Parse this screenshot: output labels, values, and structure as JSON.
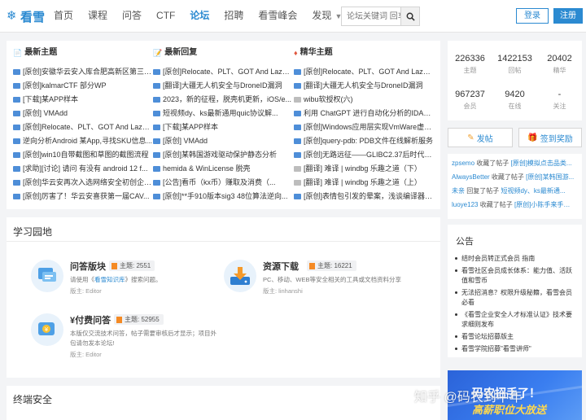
{
  "header": {
    "logo_text": "看雪",
    "nav": [
      "首页",
      "课程",
      "问答",
      "CTF",
      "论坛",
      "招聘",
      "看雪峰会",
      "发现"
    ],
    "active_nav": "论坛",
    "search_placeholder": "论坛关键词 回车",
    "login": "登录",
    "register": "注册"
  },
  "topics": {
    "latest": {
      "title": "最新主题",
      "items": [
        "[原创]安徽华云安入库合肥高新区第三批...",
        "[原创]kalmarCTF 部分WP",
        "[下载]某APP样本",
        "[原创] VMAdd",
        "[原创]Relocate、PLT、GOT And Lazy Bin...",
        "逆向分析Android 某App,寻找SKU信息...",
        "[原创]win10自带截图和草图的截图流程",
        "[求助][讨论] 请问 有没有 android 12 f...",
        "[原创]华云安再次入选网络安全初创企业...",
        "[原创]厉害了！华云安喜获第一届CAV..."
      ]
    },
    "replies": {
      "title": "最新回复",
      "items": [
        "[原创]Relocate、PLT、GOT And Lazy Bi...",
        "[翻译]大疆无人机安全与DroneID漏洞",
        "2023，新的征程，脱壳机更新，iOS/e...",
        "短视频dy、ks最新通用quic协议解...",
        "[下载]某APP样本",
        "[原创] VMAdd",
        "[原创]某韩国游戏驱动保护静态分析",
        "hemida & WinLicense 脱壳",
        "[公告]看币（kx币）赚取及消费（...",
        "[原创]**手910版本sig3 48位算法逆向..."
      ]
    },
    "featured": {
      "title": "精华主题",
      "items": [
        "[原创]Relocate、PLT、GOT And Lazy Bin...",
        "[翻译]大疆无人机安全与DroneID漏洞",
        "wibu软授权(六)",
        "利用 ChatGPT 进行自动化分析的IDA插件...",
        "[原创]Windows应用层实现VmWare虚拟...",
        "[原创]query-pdb: PDB文件在线解析服务",
        "[原创]无路远征——GLIBC2.37后时代的I...",
        "[翻译] 难译 | windbg 乐趣之道（下）",
        "[翻译] 难译 | windbg 乐趣之道（上）",
        "[原创]表情包引发的晕案，浅谈编译器优化"
      ]
    }
  },
  "stats": [
    {
      "num": "226336",
      "label": "主题"
    },
    {
      "num": "1422153",
      "label": "回帖"
    },
    {
      "num": "20402",
      "label": "精华"
    },
    {
      "num": "967237",
      "label": "会员"
    },
    {
      "num": "9420",
      "label": "在线"
    },
    {
      "num": "-",
      "label": "关注"
    }
  ],
  "actions": {
    "post": "发帖",
    "signin": "签到奖励"
  },
  "activity": [
    {
      "user": "zpsemo",
      "verb": " 收藏了帖子 ",
      "link": "[原创]模拟点击品类..."
    },
    {
      "user": "AlwaysBetter",
      "verb": " 收藏了帖子 ",
      "link": "[原创]某韩国游..."
    },
    {
      "user": "未亲",
      "verb": " 回复了帖子 ",
      "link": "短视频dy、ks最新通..."
    },
    {
      "user": "luoye123",
      "verb": " 收藏了帖子 ",
      "link": "[原创]小陈手来手…"
    }
  ],
  "study": {
    "title": "学习园地",
    "cards": [
      {
        "name": "问答版块",
        "badge": "主题: 2551",
        "desc_pre": "请使用《",
        "desc_link": "看雪知识库",
        "desc_post": "》搜索问题。",
        "mod": "版主:  Editor"
      },
      {
        "name": "资源下载",
        "badge": "主题: 16221",
        "desc": "PC、移动、WEB等安全相关的工具或文档资料分享",
        "mod": "版主:  linhanshi"
      },
      {
        "name": "¥付费问答",
        "badge": "主题: 52955",
        "desc": "本版仅交流技术问答，帖子需要审核后才显示；项目外包请勿发本论坛!",
        "mod": "版主:  Editor"
      }
    ]
  },
  "notice": {
    "title": "公告",
    "items": [
      "结时会员转正式会员 指南",
      "看雪社区会员成长体系：能力值、活跃值和雪币",
      "无法招消息？权限升级秘籍，看雪会员必看",
      "《看雪企业安全人才标准认证》技术要求细则发布",
      "看雪论坛招募版主",
      "看雪学院招募\"看雪讲师\""
    ]
  },
  "ad": {
    "line1": "码农招手了！",
    "line2": "高薪职位大放送"
  },
  "bottom": {
    "title": "终端安全"
  },
  "watermark": "知乎 @码农到中年",
  "colors": {
    "brand": "#2b8ad1",
    "accent": "#f58a24",
    "bg": "#f3f4f6"
  }
}
